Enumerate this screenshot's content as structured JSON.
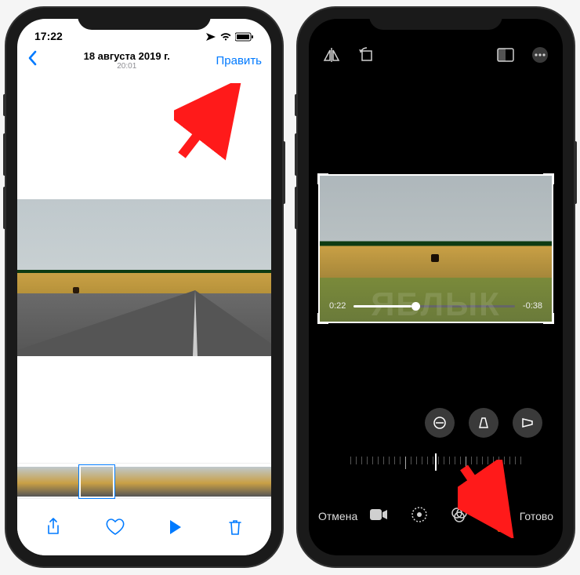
{
  "left": {
    "status": {
      "time": "17:22"
    },
    "nav": {
      "date": "18 августа 2019 г.",
      "time": "20:01",
      "edit": "Править"
    }
  },
  "right": {
    "scrubber": {
      "current": "0:22",
      "remaining": "-0:38"
    },
    "footer": {
      "cancel": "Отмена",
      "done": "Готово"
    },
    "watermark": "ЯБЛЫК"
  }
}
